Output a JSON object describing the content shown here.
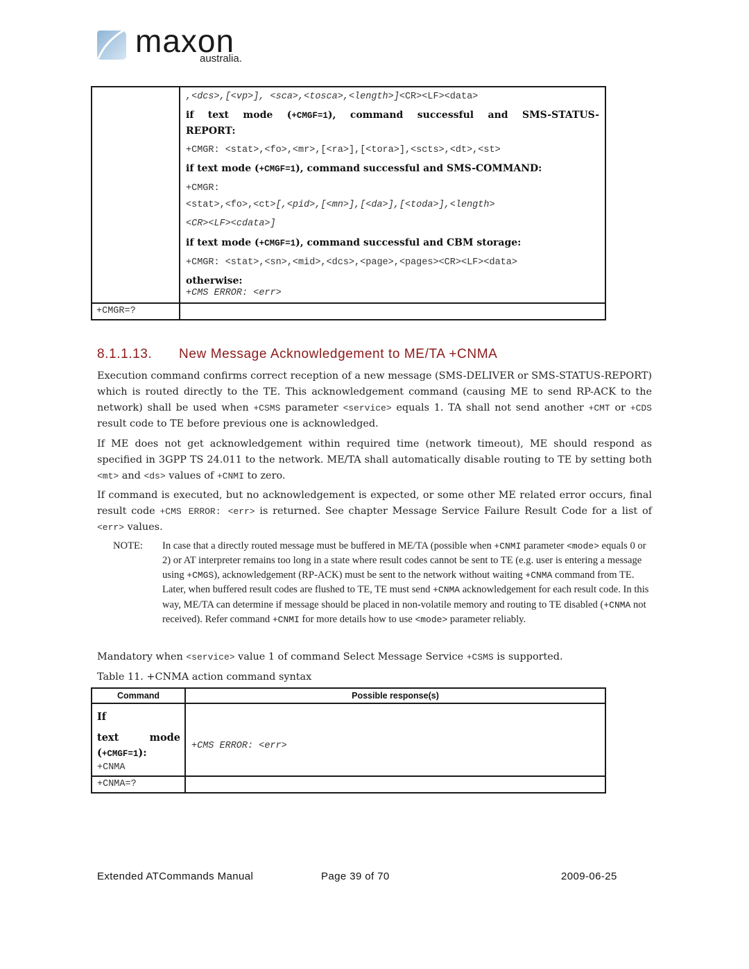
{
  "logo": {
    "brand": "maxon",
    "sub": "australia."
  },
  "table1": {
    "rows": [
      {
        "command": "",
        "lines": {
          "l1_italic": ",<dcs>,[<vp>], <sca>,<tosca>,<length>]",
          "l1_plain": "<CR><LF><data>",
          "h_status_a": "if text mode (",
          "h_status_code": "+CMGF=1",
          "h_status_b": "), command successful and SMS-STATUS-",
          "h_status_c": "REPORT:",
          "status_resp": "+CMGR: <stat>,<fo>,<mr>,[<ra>],[<tora>],<scts>,<dt>,<st>",
          "h_command_a": "if text mode (",
          "h_command_code": "+CMGF=1",
          "h_command_b": "), command successful and SMS-COMMAND:",
          "command_resp_1": "+CMGR:",
          "command_resp_2_plain": "<stat>,<fo>,<ct>",
          "command_resp_2_italic": "[,<pid>,[<mn>],[<da>],[<toda>],<length>",
          "command_resp_3": "<CR><LF><cdata>]",
          "h_cbm_a": "if text mode (",
          "h_cbm_code": "+CMGF=1",
          "h_cbm_b": "), command successful and CBM storage:",
          "cbm_resp": "+CMGR: <stat>,<sn>,<mid>,<dcs>,<page>,<pages><CR><LF><data>",
          "otherwise": "otherwise:",
          "error": "+CMS ERROR: <err>"
        }
      },
      {
        "command": "+CMGR=?",
        "response": ""
      }
    ]
  },
  "section": {
    "number": "8.1.1.13.",
    "title": "New Message Acknowledgement to ME/TA +CNMA"
  },
  "paragraphs": {
    "p1": {
      "a": "Execution command confirms correct reception of a new message (SMS-DELIVER or SMS-STATUS-REPORT) which is routed directly to the TE. This acknowledgement command (causing ME to send RP-ACK to the network) shall be used when ",
      "m1": "+CSMS",
      "b": " parameter ",
      "m2": "<service>",
      "c": " equals 1. TA shall not send another ",
      "m3": "+CMT",
      "d": " or ",
      "m4": "+CDS",
      "e": " result code to TE before previous one is acknowledged."
    },
    "p2": {
      "a": "If ME does not get acknowledgement within required time (network timeout), ME should respond as specified in 3GPP TS 24.011  to the network.  ME/TA shall automatically disable routing to TE by setting both ",
      "m1": "<mt>",
      "b": " and ",
      "m2": "<ds>",
      "c": " values of ",
      "m3": "+CNMI",
      "d": " to zero."
    },
    "p3": {
      "a": "If command is executed, but no acknowledgement is expected, or some other ME related error occurs, final result code ",
      "m1": "+CMS ERROR: <err>",
      "b": " is returned. See chapter Message Service Failure Result Code for a list of ",
      "m2": "<err>",
      "c": " values."
    },
    "p4": {
      "a": "Mandatory when ",
      "m1": "<service>",
      "b": " value 1 of command Select Message Service ",
      "m2": "+CSMS",
      "c": " is supported."
    }
  },
  "note": {
    "label": "NOTE:",
    "t1": "In case that a directly routed message must be buffered in ME/TA (possible when ",
    "m1": "+CNMI",
    "t2": " parameter ",
    "m2": "<mode>",
    "t3": " equals 0 or 2) or AT interpreter remains too long in a state where result codes cannot be sent to TE (e.g. user is entering a message using ",
    "m3": "+CMGS",
    "t4": "), acknowledgement (RP-ACK) must be sent to the network without waiting ",
    "m4": "+CNMA",
    "t5": " command from TE. Later, when buffered result codes are flushed to TE, TE must send ",
    "m5": "+CNMA",
    "t6": " acknowledgement for each result code. In this way, ME/TA can determine if message should be placed in non-volatile memory and routing to TE disabled (",
    "m6": "+CNMA",
    "t7": " not received). Refer command ",
    "m7": "+CNMI",
    "t8": " for more details how to use ",
    "m8": "<mode>",
    "t9": " parameter reliably."
  },
  "table2": {
    "caption": "Table 11. +CNMA action command syntax",
    "headers": [
      "Command",
      "Possible response(s)"
    ],
    "rows": [
      {
        "cmd_if": "If",
        "cmd_text": "text",
        "cmd_mode": "mode",
        "cmd_open": "(",
        "cmd_code": "+CMGF=1",
        "cmd_close": "):",
        "cmd_name": "+CNMA",
        "response": "+CMS ERROR: <err>"
      },
      {
        "cmd_name": "+CNMA=?",
        "response": ""
      }
    ]
  },
  "footer": {
    "title": "Extended ATCommands Manual",
    "page": "Page 39 of 70",
    "date": "2009-06-25"
  }
}
